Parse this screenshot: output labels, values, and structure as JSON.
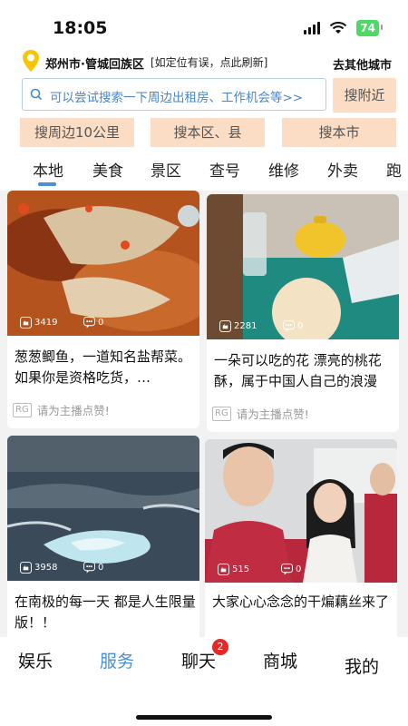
{
  "status_bar": {
    "time": "18:05",
    "battery": "74"
  },
  "location": {
    "city": "郑州市·管城回族区",
    "hint": "[如定位有误，点此刷新]",
    "other_city_label": "去其他城市"
  },
  "search": {
    "placeholder": "可以尝试搜索一下周边出租房、工作机会等>>",
    "nearby_button": "搜附近"
  },
  "filter_chips": [
    "搜周边10公里",
    "搜本区、县",
    "搜本市"
  ],
  "tabs": [
    "本地",
    "美食",
    "景区",
    "查号",
    "维修",
    "外卖",
    "跑"
  ],
  "active_tab": "本地",
  "feed": [
    {
      "title": "葱葱鲫鱼，一道知名盐帮菜。如果你是资格吃货，…",
      "likes": "3419",
      "comments": "0",
      "like_prompt": "请为主播点赞!",
      "badge": "RG"
    },
    {
      "title": "一朵可以吃的花 漂亮的桃花酥，属于中国人自己的浪漫",
      "likes": "2281",
      "comments": "0",
      "like_prompt": "请为主播点赞!",
      "badge": "RG"
    },
    {
      "title": "在南极的每一天 都是人生限量版！！",
      "likes": "3958",
      "comments": "0"
    },
    {
      "title": "大家心心念念的干煸藕丝来了",
      "likes": "515",
      "comments": "0"
    }
  ],
  "bottom_nav": {
    "items": [
      "娱乐",
      "服务",
      "聊天",
      "商城",
      "我的"
    ],
    "active": "服务",
    "chat_badge": "2"
  },
  "colors": {
    "accent": "#4a8fd8",
    "chip_bg": "#fbdcc4",
    "badge": "#e62828",
    "battery": "#4cd964"
  }
}
